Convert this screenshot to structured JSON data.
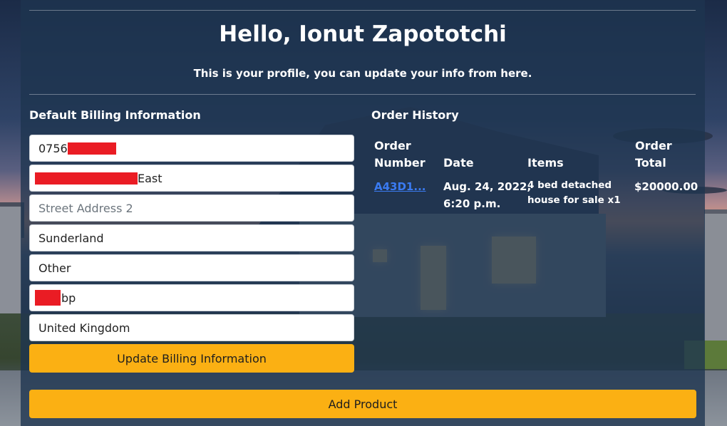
{
  "header": {
    "greeting": "Hello, Ionut Zapototchi",
    "subtitle": "This is your profile, you can update your info from here."
  },
  "billing": {
    "title": "Default Billing Information",
    "phone_prefix": "0756",
    "address1_suffix": "East",
    "address2_placeholder": "Street Address 2",
    "city": "Sunderland",
    "region": "Other",
    "postcode_suffix": "bp",
    "country": "United Kingdom",
    "update_label": "Update Billing Information"
  },
  "orders": {
    "title": "Order History",
    "columns": {
      "number_line1": "Order",
      "number_line2": "Number",
      "date": "Date",
      "items": "Items",
      "total_line1": "Order",
      "total_line2": "Total"
    },
    "rows": [
      {
        "number": "A43D1...",
        "date_line1": "Aug. 24, 2022,",
        "date_line2": "6:20 p.m.",
        "items_line1": "4 bed detached",
        "items_line2": "house for sale x1",
        "total": "$20000.00"
      }
    ]
  },
  "actions": {
    "add_product_label": "Add Product"
  },
  "colors": {
    "accent": "#fbb013",
    "panel": "#1e3450",
    "link": "#3a7bf2",
    "redaction": "#ea1c24"
  }
}
